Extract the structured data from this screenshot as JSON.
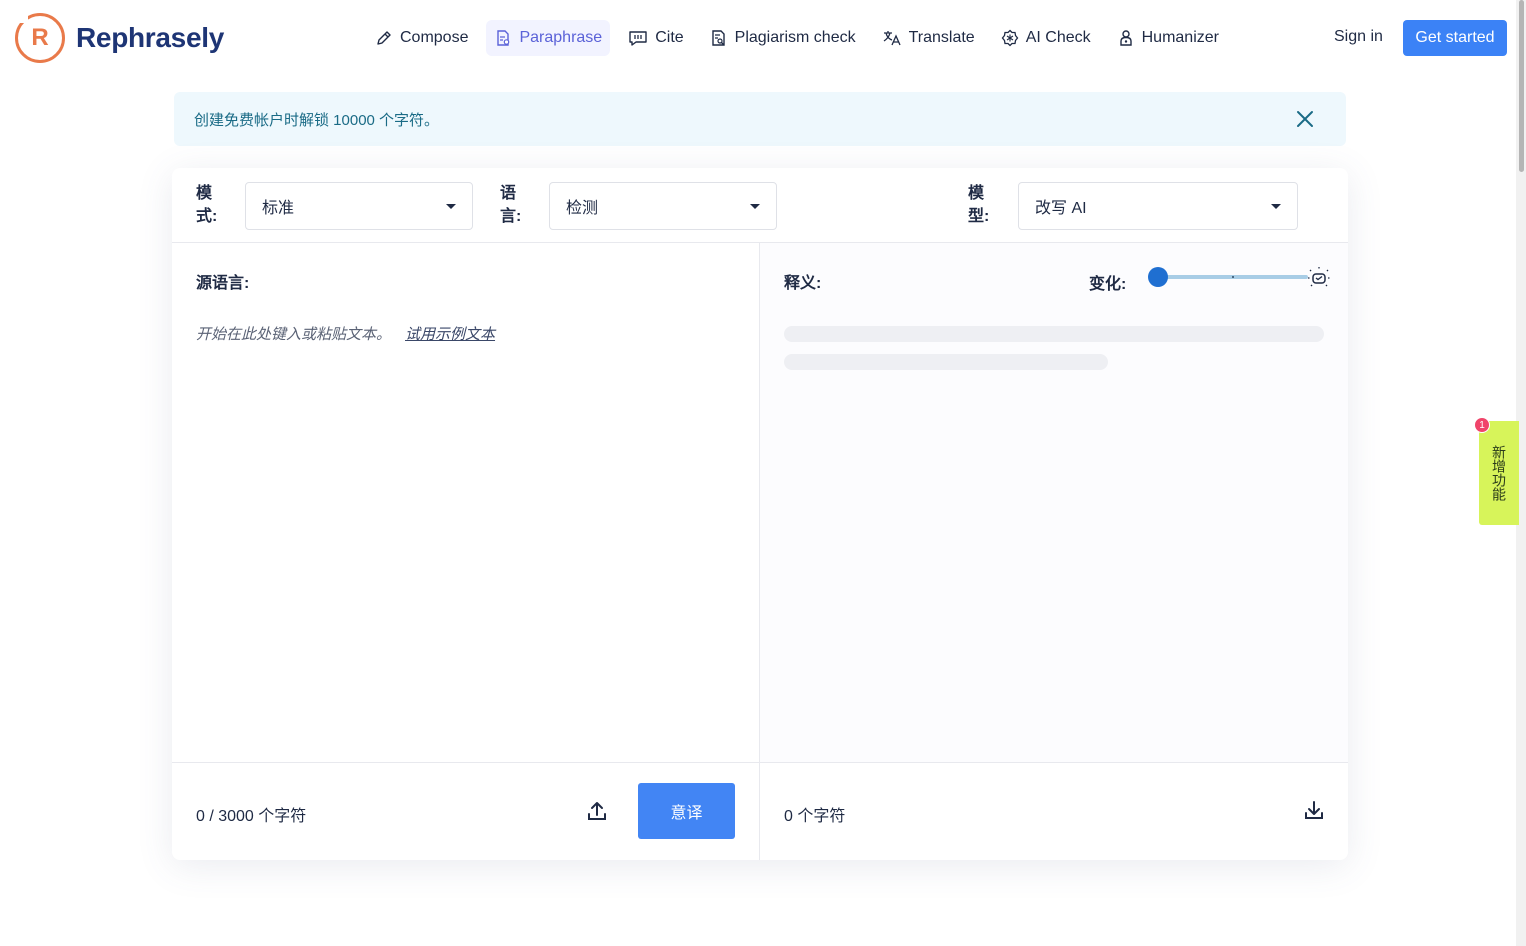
{
  "header": {
    "logo_letter": "R",
    "logo_text": "Rephrasely",
    "nav": [
      {
        "label": "Compose",
        "icon": "pen-icon"
      },
      {
        "label": "Paraphrase",
        "icon": "document-edit-icon"
      },
      {
        "label": "Cite",
        "icon": "quote-bubble-icon"
      },
      {
        "label": "Plagiarism check",
        "icon": "document-search-icon"
      },
      {
        "label": "Translate",
        "icon": "translate-icon"
      },
      {
        "label": "AI Check",
        "icon": "ai-badge-icon"
      },
      {
        "label": "Humanizer",
        "icon": "person-icon"
      }
    ],
    "active_nav": "Paraphrase",
    "sign_in": "Sign in",
    "get_started": "Get started"
  },
  "banner": {
    "text": "创建免费帐户时解锁 10000 个字符。"
  },
  "toolbar": {
    "mode_label": "模式:",
    "mode_value": "标准",
    "language_label": "语言:",
    "language_value": "检测",
    "model_label": "模型:",
    "model_value": "改写 AI"
  },
  "source": {
    "title": "源语言:",
    "placeholder": "开始在此处键入或粘贴文本。",
    "sample_link": "试用示例文本",
    "count": "0 / 3000 个字符",
    "button": "意译"
  },
  "output": {
    "title": "释义:",
    "change_label": "变化:",
    "slider_level": 0,
    "count": "0 个字符"
  },
  "side_tab": {
    "label": "新增功能",
    "badge": "1"
  },
  "colors": {
    "brand": "#1e3575",
    "logo": "#e97a4a",
    "accent": "#3b82f6",
    "active_nav": "#5b62d8",
    "banner_bg": "#eef8fd",
    "feature_tab": "#d7f45a",
    "badge": "#f0446a"
  }
}
